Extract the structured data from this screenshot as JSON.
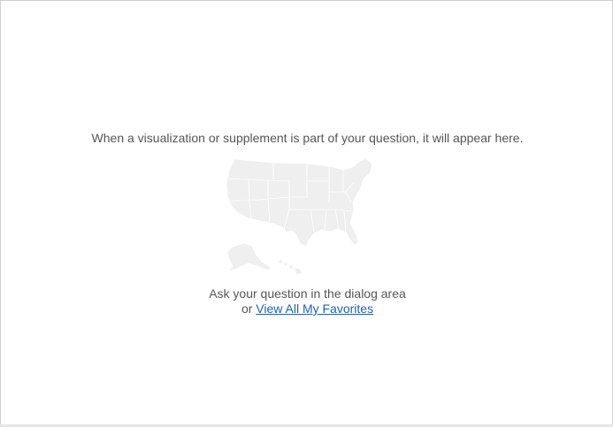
{
  "main": {
    "placeholder_message": "When a visualization or supplement is part of your question, it will appear here.",
    "prompt_line1": "Ask your question in the dialog area",
    "prompt_line2_prefix": "or",
    "favorites_link": "View All My Favorites",
    "map_icon": "us-map-icon"
  },
  "colors": {
    "text": "#555555",
    "link": "#1f5fb3",
    "map_fill": "#efefef",
    "map_stroke": "#ffffff",
    "border": "#cfcfcf"
  }
}
